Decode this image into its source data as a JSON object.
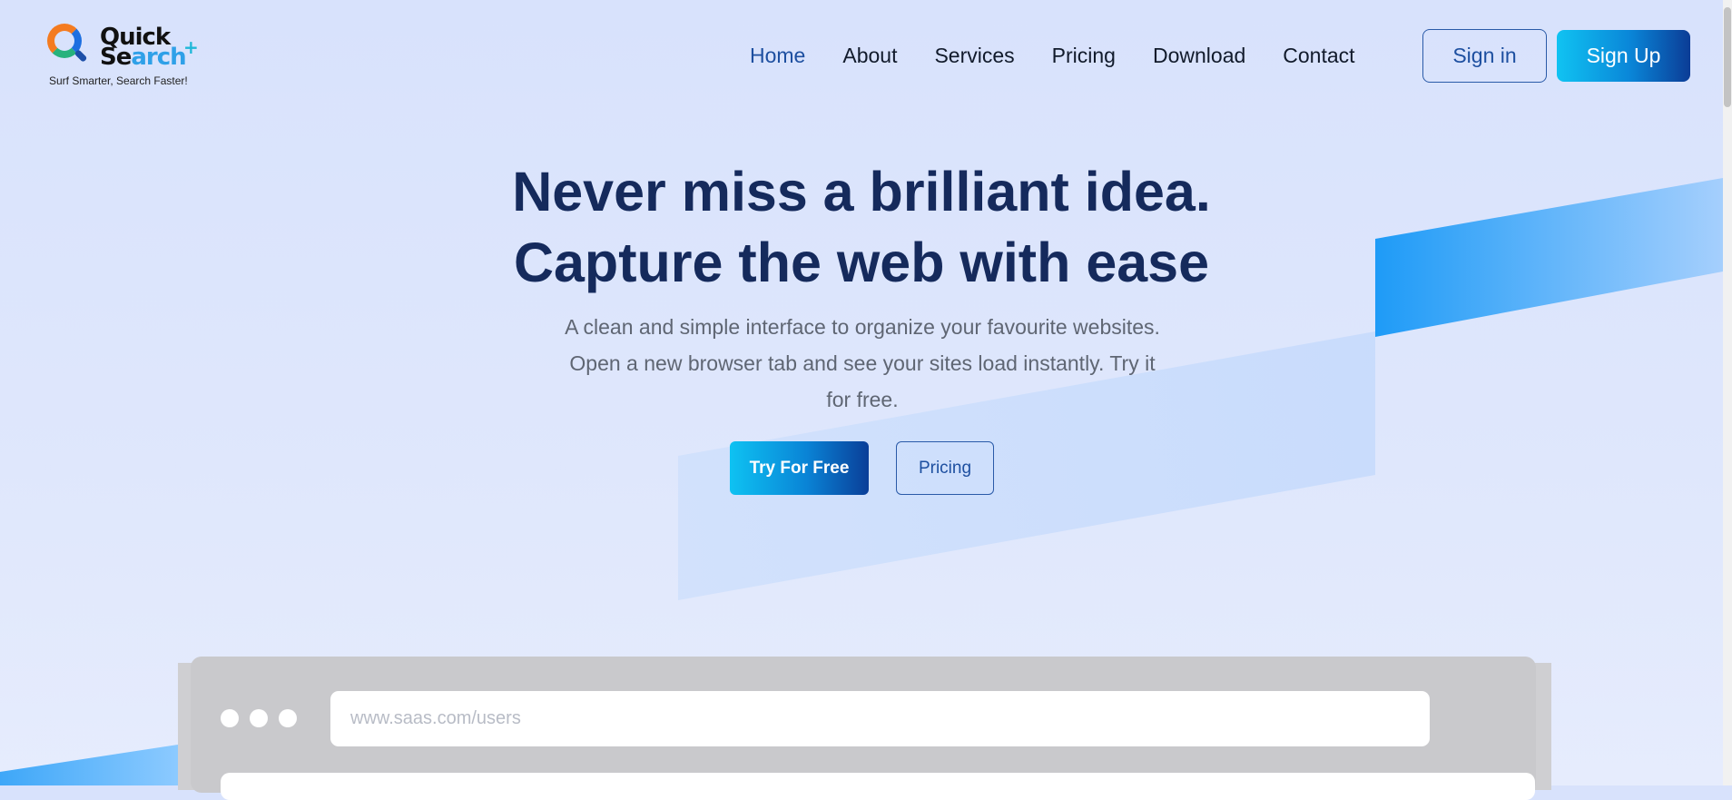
{
  "brand": {
    "name_line1": "Quick",
    "name_line2_a": "Se",
    "name_line2_b": "arch",
    "plus": "+",
    "tagline": "Surf Smarter, Search Faster!"
  },
  "nav": {
    "items": [
      {
        "label": "Home",
        "active": true
      },
      {
        "label": "About"
      },
      {
        "label": "Services"
      },
      {
        "label": "Pricing"
      },
      {
        "label": "Download"
      },
      {
        "label": "Contact"
      }
    ],
    "signin": "Sign in",
    "signup": "Sign Up"
  },
  "hero": {
    "title_line1": "Never miss a brilliant idea.",
    "title_line2": "Capture the web with ease",
    "subtitle": "A clean and simple interface to organize your favourite websites. Open a new browser tab and see your sites load instantly. Try it for free.",
    "cta_primary": "Try For Free",
    "cta_secondary": "Pricing"
  },
  "mock_browser": {
    "url_placeholder": "www.saas.com/users"
  },
  "colors": {
    "primary": "#152a5c",
    "accent": "#0a86d8",
    "active_nav": "#1d4fa0"
  }
}
